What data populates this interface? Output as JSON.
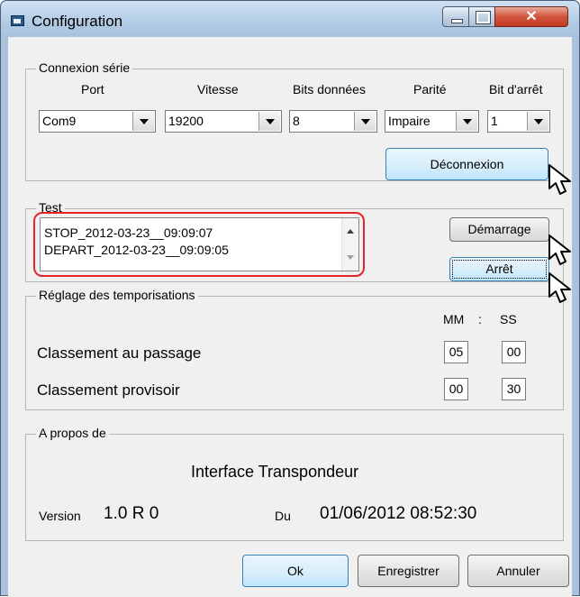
{
  "window": {
    "title": "Configuration"
  },
  "serial": {
    "legend": "Connexion série",
    "headers": {
      "port": "Port",
      "speed": "Vitesse",
      "data_bits": "Bits données",
      "parity": "Parité",
      "stop_bit": "Bit d'arrêt"
    },
    "values": {
      "port": "Com9",
      "speed": "19200",
      "data_bits": "8",
      "parity": "Impaire",
      "stop_bit": "1"
    },
    "disconnect_label": "Déconnexion"
  },
  "test": {
    "legend": "Test",
    "log": [
      "STOP_2012-03-23__09:09:07",
      "DEPART_2012-03-23__09:09:05"
    ],
    "start_label": "Démarrage",
    "stop_label": "Arrêt"
  },
  "timers": {
    "legend": "Réglage des temporisations",
    "mm": "MM",
    "sep": ":",
    "ss": "SS",
    "rows": [
      {
        "label": "Classement au passage",
        "mm": "05",
        "ss": "00"
      },
      {
        "label": "Classement provisoir",
        "mm": "00",
        "ss": "30"
      }
    ]
  },
  "about": {
    "legend": "A propos de",
    "name": "Interface Transpondeur",
    "version_label": "Version",
    "version": "1.0 R 0",
    "date_label": "Du",
    "date": "01/06/2012 08:52:30"
  },
  "footer": {
    "ok_label": "Ok",
    "save_label": "Enregistrer",
    "cancel_label": "Annuler"
  },
  "colors": {
    "highlight": "#e3252b",
    "titlebar": "#b4cde6",
    "close": "#c13a20"
  }
}
